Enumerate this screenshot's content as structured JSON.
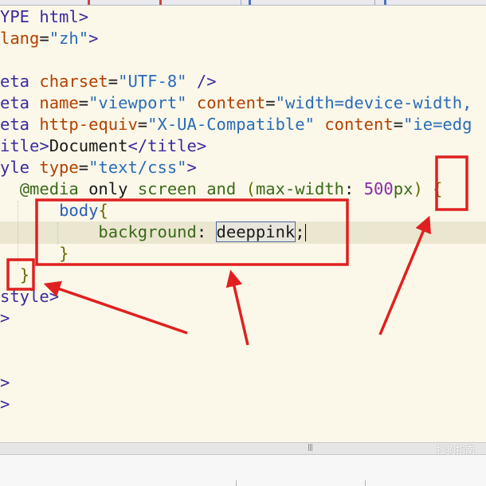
{
  "code": {
    "l1_doctype": "YPE html",
    "l2_lang_attr": "lang",
    "l2_lang_val": "\"zh\"",
    "l4_tag": "eta",
    "l4_attr": "charset",
    "l4_val": "\"UTF-8\"",
    "l4_close": " />",
    "l5_tag": "eta",
    "l5_attr1": "name",
    "l5_val1": "\"viewport\"",
    "l5_attr2": "content",
    "l5_val2": "\"width=device-width,",
    "l6_tag": "eta",
    "l6_attr1": "http-equiv",
    "l6_val1": "\"X-UA-Compatible\"",
    "l6_attr2": "content",
    "l6_val2": "\"ie=edg",
    "l7_tag_open": "itle",
    "l7_text": "Document",
    "l7_tag_close": "/title",
    "l8_tag": "yle",
    "l8_attr": "type",
    "l8_val": "\"text/css\"",
    "l9_at": "@media",
    "l9_only": "only",
    "l9_screen": "screen",
    "l9_and": "and",
    "l9_prop": "max-width",
    "l9_num": "500",
    "l9_unit": "px",
    "l10_selector": "body",
    "l11_prop": "background",
    "l11_value": "deeppink",
    "l14_close": "style"
  },
  "statusbar": {
    "grip": "|||",
    "watermark": "搜狗指南"
  },
  "colors": {
    "annotation_red": "#e02020",
    "editor_bg": "#fbf8e9",
    "current_line": "#ebe6cf"
  }
}
